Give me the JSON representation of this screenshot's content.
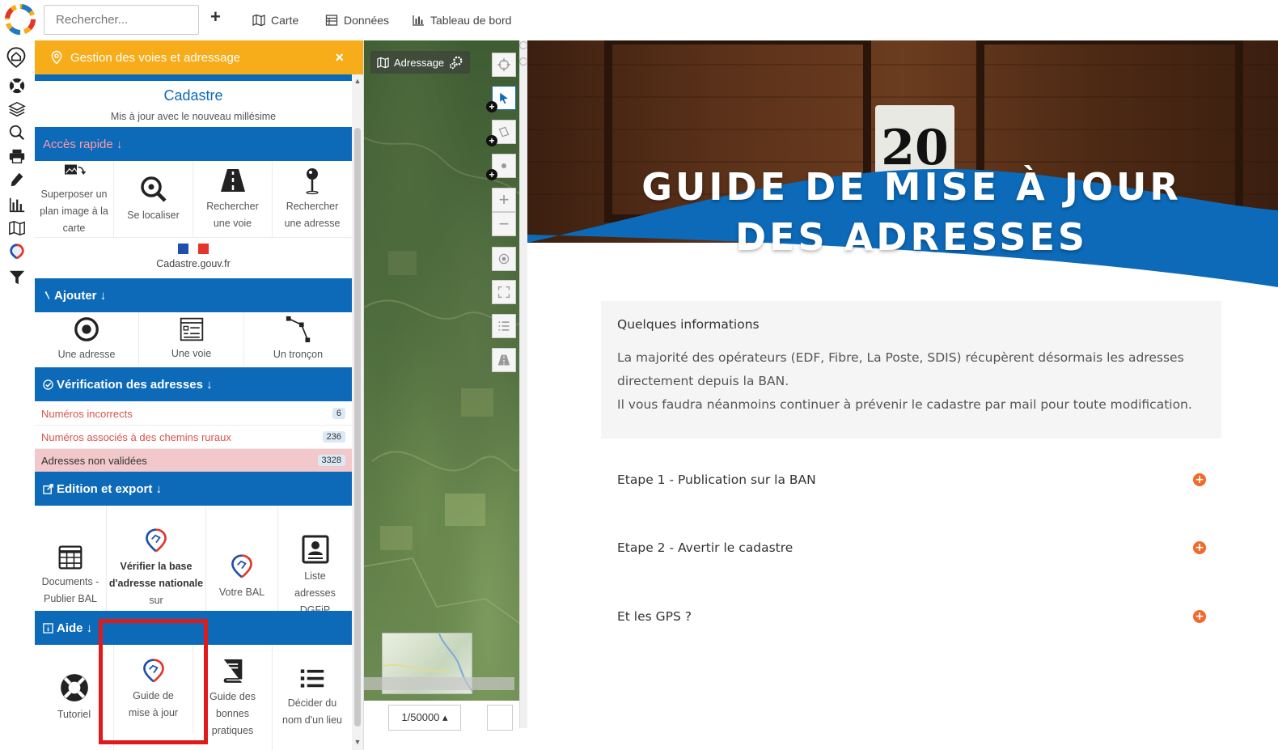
{
  "topbar": {
    "search_placeholder": "Rechercher...",
    "plus": "+",
    "carte": "Carte",
    "donnees": "Données",
    "tableau": "Tableau de bord"
  },
  "panel": {
    "title": "Gestion des voies et adressage",
    "close": "×",
    "cadastre_title": "Cadastre",
    "cadastre_sub": "Mis à jour avec le nouveau millésime",
    "acces_rapide": "Accès rapide ↓",
    "quick_tiles": [
      {
        "label": "Superposer un plan image à la carte"
      },
      {
        "label": "Se localiser"
      },
      {
        "label": "Rechercher une voie"
      },
      {
        "label": "Rechercher une adresse"
      }
    ],
    "cadastre_gouv": "Cadastre.gouv.fr",
    "ajouter": "Ajouter ↓",
    "add_tiles": [
      {
        "label": "Une adresse"
      },
      {
        "label": "Une voie"
      },
      {
        "label": "Un tronçon"
      }
    ],
    "verification": "Vérification des adresses ↓",
    "checks": [
      {
        "label": "Numéros incorrects",
        "count": "6"
      },
      {
        "label": "Numéros associés à des chemins ruraux",
        "count": "236"
      },
      {
        "label": "Adresses non validées",
        "count": "3328"
      }
    ],
    "edition": "Edition et export ↓",
    "edit_tiles": [
      {
        "label": "Documents - Publier BAL"
      },
      {
        "label_bold": "Vérifier la base d'adresse nationale",
        "label_rest": "sur adresse.data.gouv.fr"
      },
      {
        "label": "Votre BAL"
      },
      {
        "label": "Liste adresses DGFiP"
      }
    ],
    "aide": "Aide ↓",
    "help_tiles": [
      {
        "label": "Tutoriel"
      },
      {
        "label": "Guide de mise à jour"
      },
      {
        "label": "Guide des bonnes pratiques"
      },
      {
        "label": "Décider du nom d'un lieu"
      }
    ]
  },
  "map": {
    "layer_label": "Adressage",
    "scale": "1/50000 ▴"
  },
  "guide": {
    "hero_number": "20",
    "hero_line1": "GUIDE DE MISE À JOUR",
    "hero_line2": "DES ADRESSES",
    "info_title": "Quelques informations",
    "info_line1": "La majorité des opérateurs (EDF, Fibre, La Poste, SDIS) récupèrent désormais les adresses",
    "info_line2": "directement depuis la BAN.",
    "info_line3": "Il vous faudra néanmoins continuer à prévenir le cadastre par mail pour toute modification.",
    "steps": [
      {
        "label": "Etape 1 - Publication sur la BAN"
      },
      {
        "label": "Etape 2 - Avertir le cadastre"
      },
      {
        "label": "Et les GPS ?"
      }
    ]
  },
  "colors": {
    "accent_orange": "#f7ac19",
    "section_blue": "#0c6ab8",
    "alert_red": "#d9534f",
    "plus_orange": "#f2682a"
  }
}
